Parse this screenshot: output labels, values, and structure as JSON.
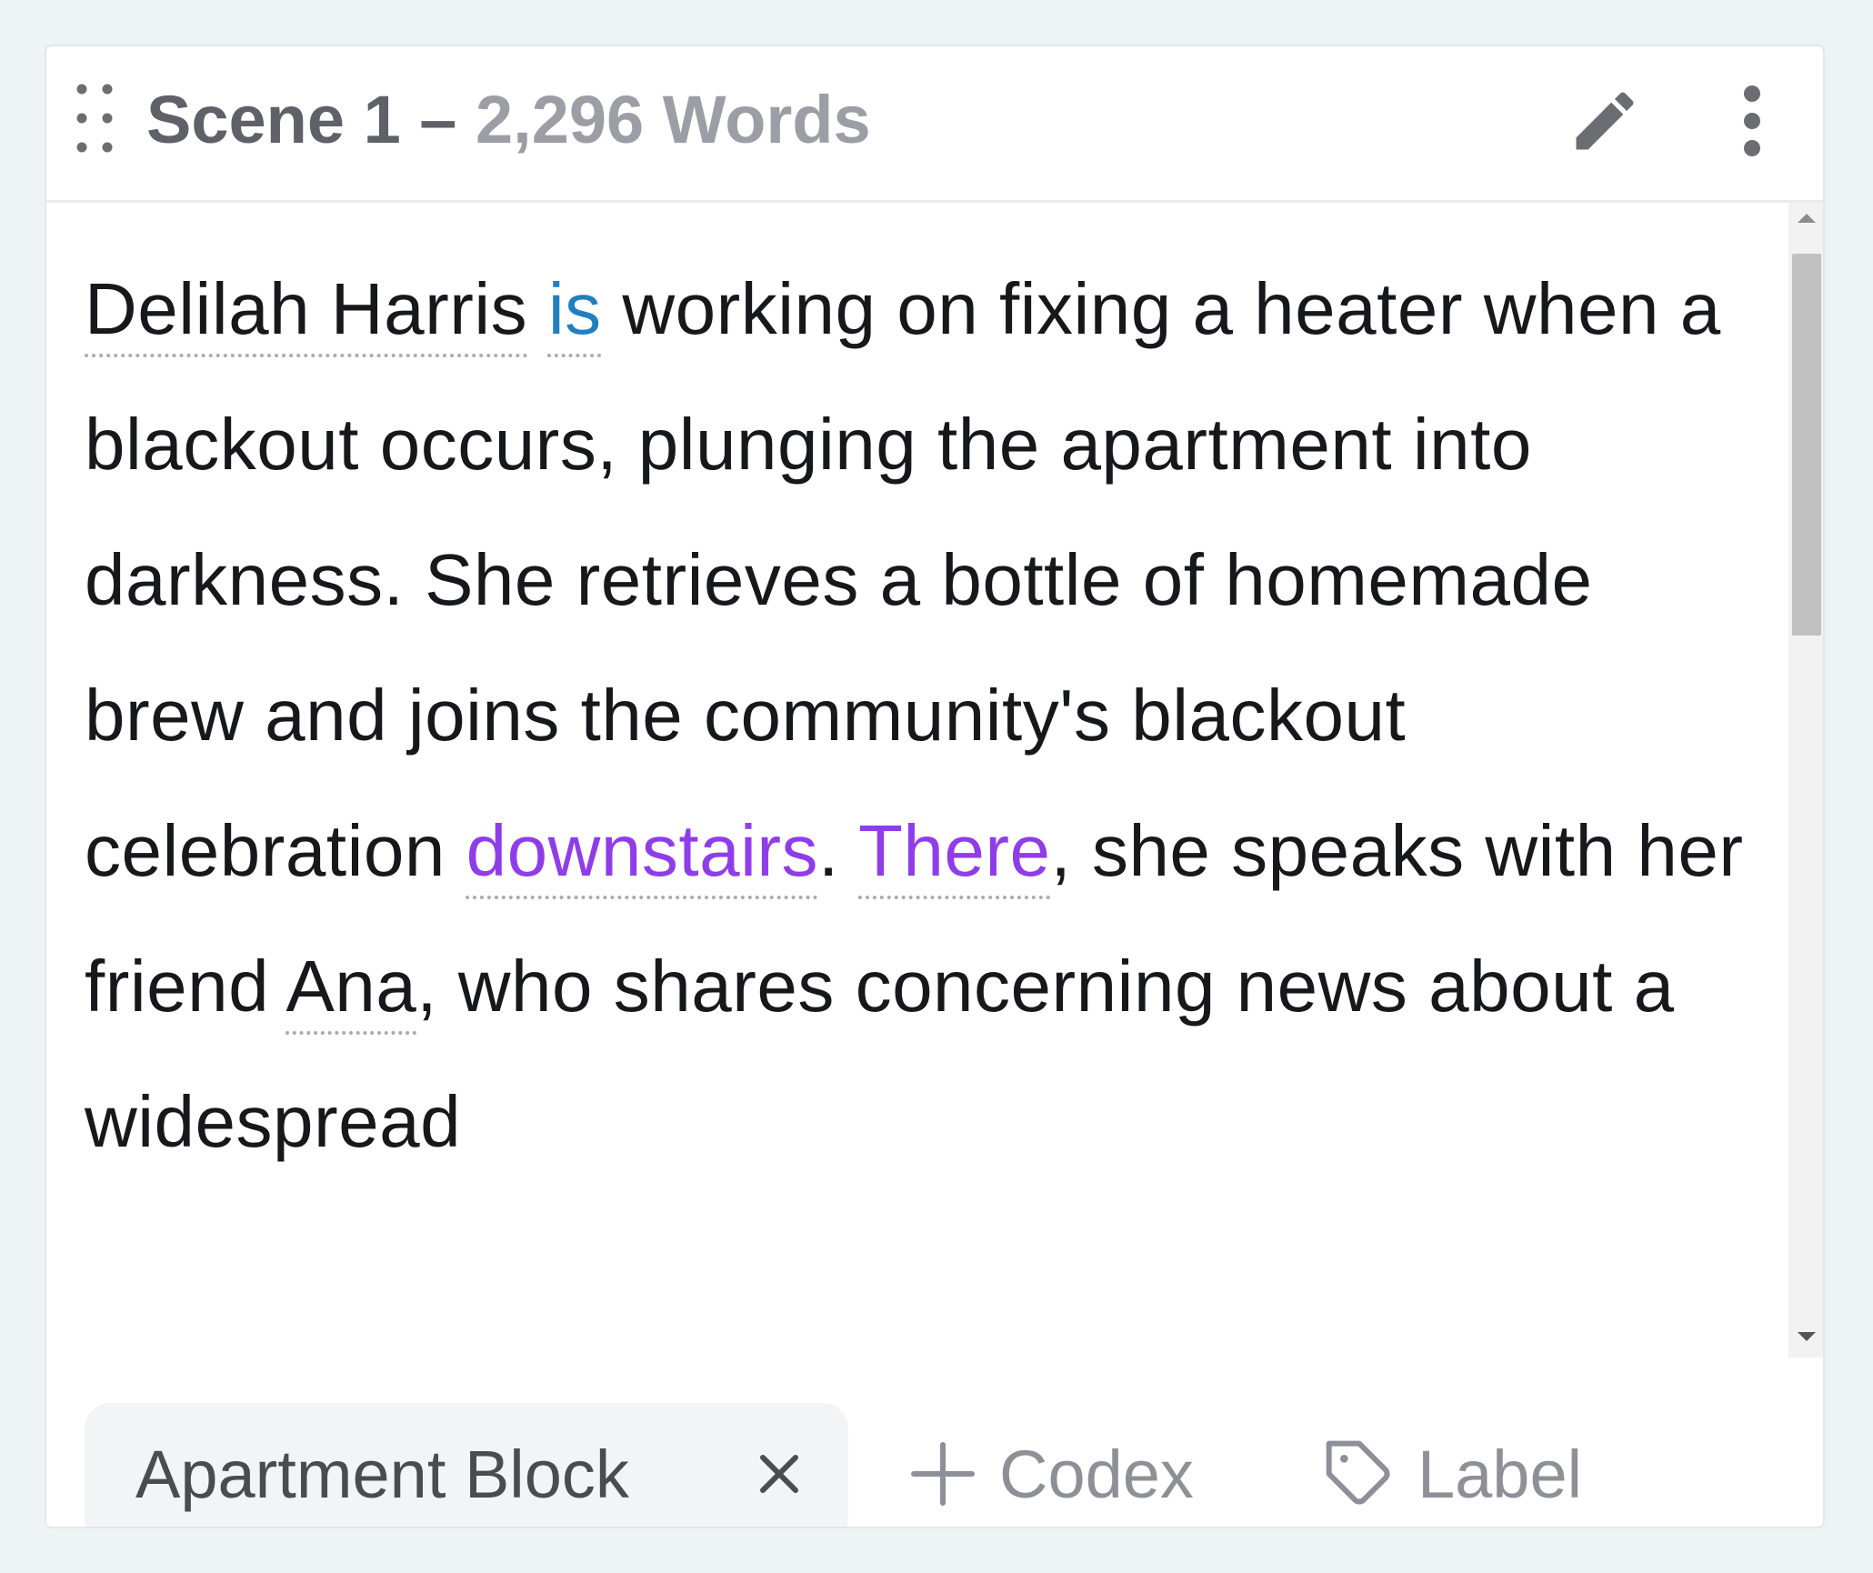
{
  "scene": {
    "title": "Scene 1 – ",
    "word_count": "2,296 Words",
    "summary": {
      "t1_mention": "Delilah Harris",
      "t2_space": " ",
      "t3_mention": "is",
      "t4": " working on fixing a heater when a blackout occurs, plunging the apartment into darkness. She retrieves a bottle of homemade brew and joins the community's blackout celebration ",
      "t5_mention": "downstairs",
      "t6": ". ",
      "t7_mention": "There",
      "t8": ", she speaks with her friend ",
      "t9_mention": "Ana",
      "t10": ", who shares concerning news about a widespread"
    }
  },
  "footer": {
    "chip_label": "Apartment Block",
    "codex_label": "Codex",
    "label_label": "Label"
  },
  "colors": {
    "mention_blue": "#1f7fbf",
    "mention_purple": "#8f3de8",
    "muted_text": "#9c9ea6"
  },
  "icons": {
    "drag": "drag-handle-icon",
    "edit": "pencil-icon",
    "more": "more-vertical-icon",
    "close": "close-icon",
    "plus": "plus-icon",
    "tag": "tag-icon"
  }
}
